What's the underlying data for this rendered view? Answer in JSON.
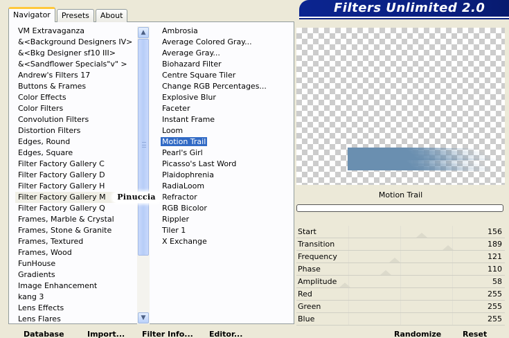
{
  "tabs": [
    "Navigator",
    "Presets",
    "About"
  ],
  "title": "Filters Unlimited 2.0",
  "categories": [
    "VM Extravaganza",
    "&<Background Designers IV>",
    "&<Bkg Designer sf10 III>",
    "&<Sandflower Specials\"v\" >",
    "Andrew's Filters 17",
    "Buttons & Frames",
    "Color Effects",
    "Color Filters",
    "Convolution Filters",
    "Distortion Filters",
    "Edges, Round",
    "Edges, Square",
    "Filter Factory Gallery C",
    "Filter Factory Gallery D",
    "Filter Factory Gallery H",
    "Filter Factory Gallery M",
    "Filter Factory Gallery Q",
    "Frames, Marble & Crystal",
    "Frames, Stone & Granite",
    "Frames, Textured",
    "Frames, Wood",
    "FunHouse",
    "Gradients",
    "Image Enhancement",
    "kang 3",
    "Lens Effects",
    "Lens Flares"
  ],
  "selected_category": "Filter Factory Gallery M",
  "filters": [
    "Ambrosia",
    "Average Colored Gray...",
    "Average Gray...",
    "Biohazard Filter",
    "Centre Square Tiler",
    "Change RGB Percentages...",
    "Explosive Blur",
    "Faceter",
    "Instant Frame",
    "Loom",
    "Motion Trail",
    "Pearl's Girl",
    "Picasso's Last Word",
    "Plaidophrenia",
    "RadiaLoom",
    "Refractor",
    "RGB Bicolor",
    "Rippler",
    "Tiler 1",
    "X Exchange"
  ],
  "selected_filter": "Motion Trail",
  "watermark": "Pinuccia",
  "bottom_buttons": [
    "Database",
    "Import...",
    "Filter Info...",
    "Editor..."
  ],
  "current_filter_name": "Motion Trail",
  "parameters": [
    {
      "label": "Start",
      "value": "156"
    },
    {
      "label": "Transition",
      "value": "189"
    },
    {
      "label": "Frequency",
      "value": "121"
    },
    {
      "label": "Phase",
      "value": "110"
    },
    {
      "label": "Amplitude",
      "value": "58"
    },
    {
      "label": "Red",
      "value": "255"
    },
    {
      "label": "Green",
      "value": "255"
    },
    {
      "label": "Blue",
      "value": "255"
    }
  ],
  "right_buttons": [
    "Randomize",
    "Reset"
  ],
  "colors": {
    "title_bg": "#0a1f80",
    "selection": "#316ac5",
    "trail": "#6a8fb0"
  }
}
